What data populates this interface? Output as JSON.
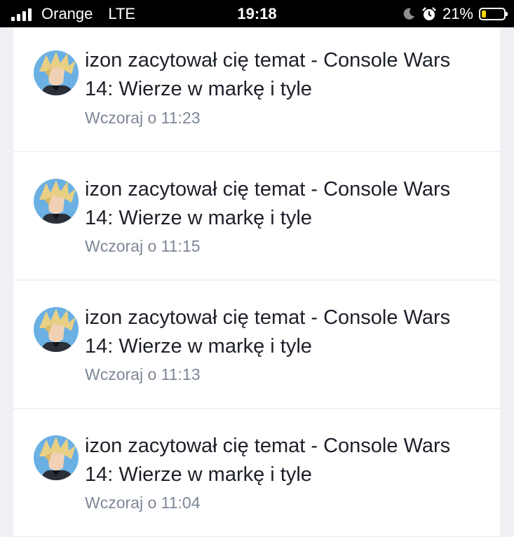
{
  "status_bar": {
    "carrier": "Orange",
    "network": "LTE",
    "time": "19:18",
    "battery_percent": "21%",
    "battery_level": 0.21,
    "icons": [
      "signal-icon",
      "moon-icon",
      "alarm-icon",
      "battery-icon"
    ]
  },
  "notifications": [
    {
      "text": "izon zacytował cię temat - Console Wars 14: Wierze w markę i tyle",
      "time": "Wczoraj o 11:23"
    },
    {
      "text": "izon zacytował cię temat - Console Wars 14: Wierze w markę i tyle",
      "time": "Wczoraj o 11:15"
    },
    {
      "text": "izon zacytował cię temat - Console Wars 14: Wierze w markę i tyle",
      "time": "Wczoraj o 11:13"
    },
    {
      "text": "izon zacytował cię temat - Console Wars 14: Wierze w markę i tyle",
      "time": "Wczoraj o 11:04"
    }
  ],
  "colors": {
    "text": "#1d2029",
    "timestamp": "#7d8698",
    "background": "#f0f1f4",
    "battery_low": "#ffd60a"
  }
}
